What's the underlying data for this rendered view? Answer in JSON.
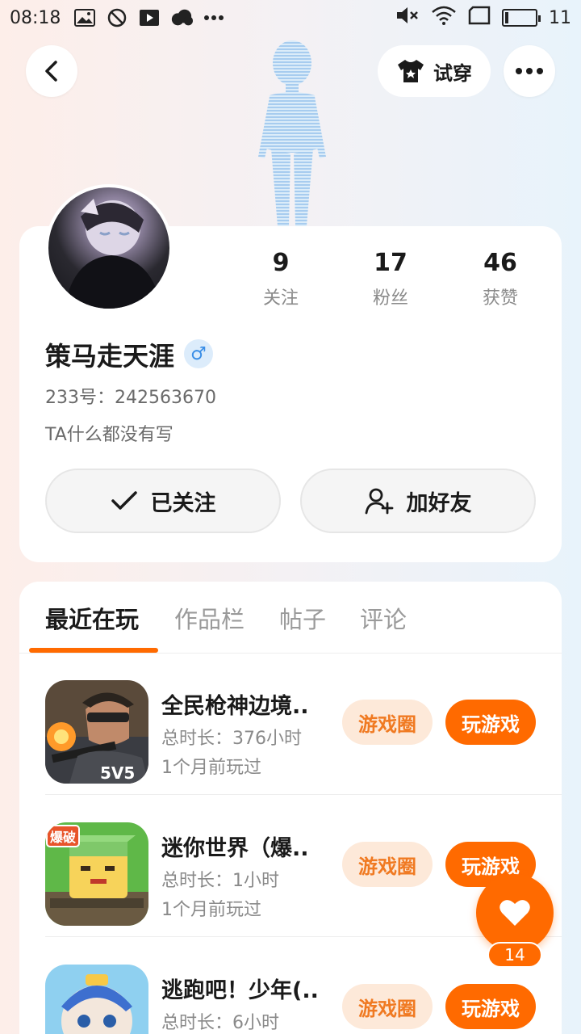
{
  "status_bar": {
    "time": "08:18",
    "battery_level": "11",
    "battery_fraction": 0.11
  },
  "header": {
    "tryon_label": "试穿"
  },
  "profile": {
    "following_count": "9",
    "following_label": "关注",
    "followers_count": "17",
    "followers_label": "粉丝",
    "likes_count": "46",
    "likes_label": "获赞",
    "username": "策马走天涯",
    "gender_symbol": "♂",
    "uid": "233号：242563670",
    "bio": "TA什么都没有写",
    "followed_label": "已关注",
    "add_friend_label": "加好友"
  },
  "tabs": [
    {
      "label": "最近在玩"
    },
    {
      "label": "作品栏"
    },
    {
      "label": "帖子"
    },
    {
      "label": "评论"
    }
  ],
  "games": [
    {
      "title": "全民枪神边境..",
      "duration": "总时长：376小时",
      "last_played": "1个月前玩过",
      "circle_label": "游戏圈",
      "play_label": "玩游戏",
      "icon": "gunner-game-icon"
    },
    {
      "title": "迷你世界（爆..",
      "duration": "总时长：1小时",
      "last_played": "1个月前玩过",
      "circle_label": "游戏圈",
      "play_label": "玩游戏",
      "icon": "block-game-icon"
    },
    {
      "title": "逃跑吧！少年(..",
      "duration": "总时长：6小时",
      "last_played": "",
      "circle_label": "游戏圈",
      "play_label": "玩游戏",
      "icon": "runner-game-icon"
    }
  ],
  "fab": {
    "count": "14"
  },
  "colors": {
    "accent": "#ff6a00",
    "accent_light": "#fde9d9",
    "gender_blue": "#3a8ee6"
  }
}
